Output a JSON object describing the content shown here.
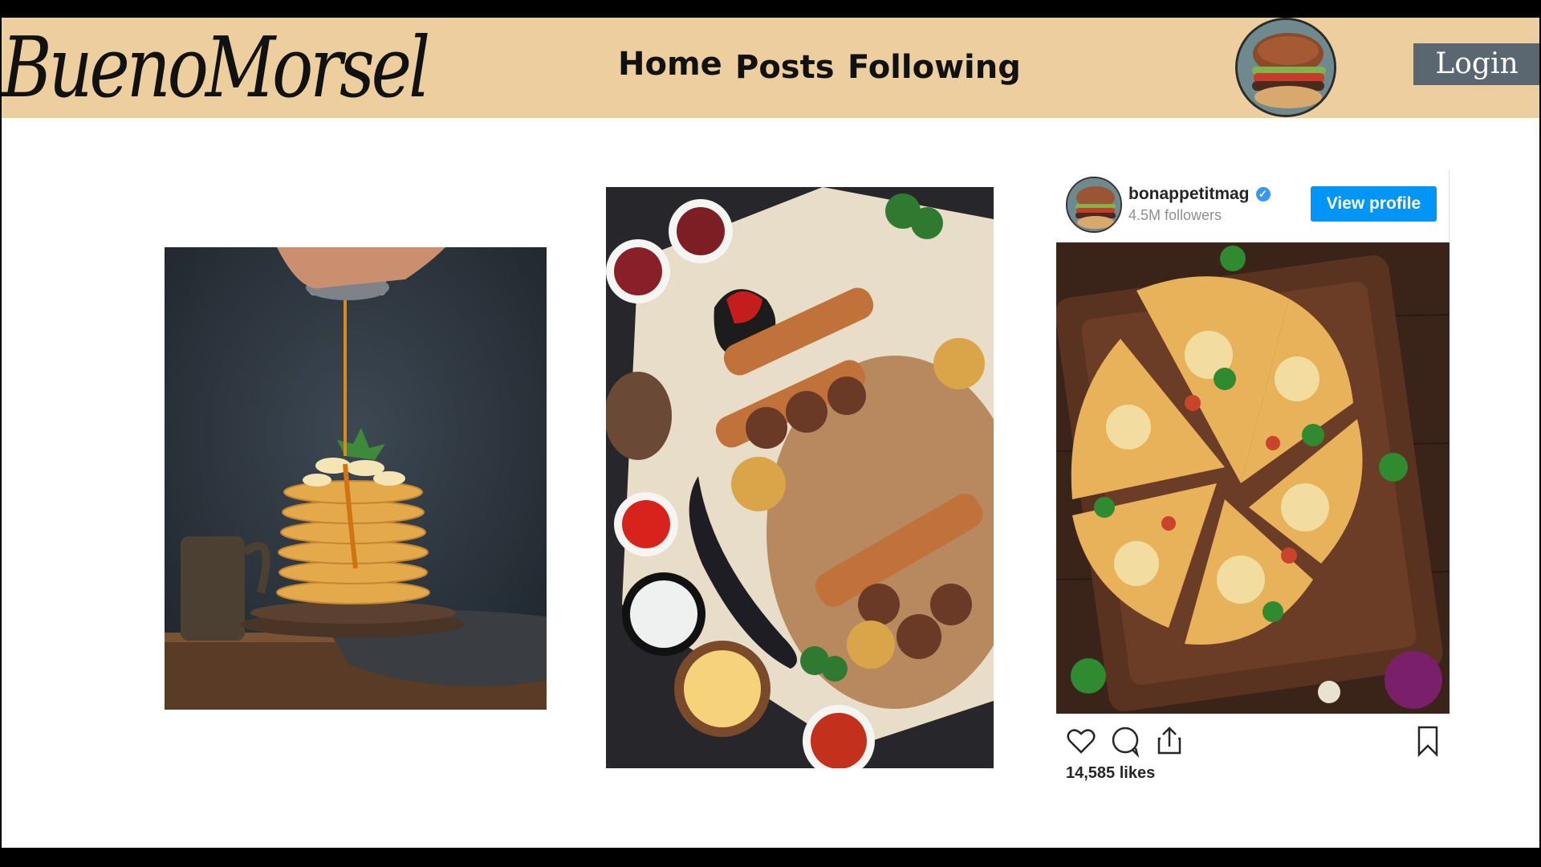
{
  "header": {
    "logo": "BuenoMorsel",
    "nav": {
      "home": "Home",
      "posts": "Posts",
      "following": "Following"
    },
    "login_label": "Login",
    "avatar_icon": "burger-avatar-icon",
    "background": "#ecce9f"
  },
  "gallery": [
    {
      "subject": "pancake-stack-photo"
    },
    {
      "subject": "grilled-skewers-photo"
    }
  ],
  "instagram": {
    "username": "bonappetitmag",
    "followers": "4.5M followers",
    "view_profile_label": "View profile",
    "likes": "14,585 likes",
    "accent": "#0095f6",
    "actions": [
      "heart-icon",
      "comment-icon",
      "share-icon",
      "bookmark-icon"
    ]
  }
}
